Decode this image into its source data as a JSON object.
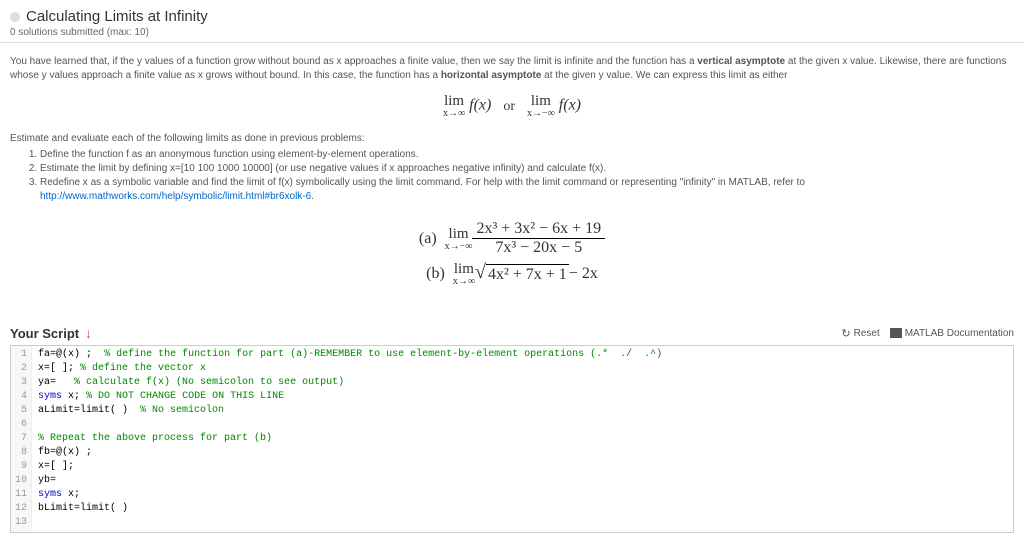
{
  "header": {
    "title": "Calculating Limits at Infinity",
    "subtitle": "0 solutions submitted (max: 10)"
  },
  "content": {
    "intro_p1": "You have learned that, if the y values of a function grow without bound as x approaches a finite value, then we say the limit is infinite and the function has a ",
    "intro_b1": "vertical asymptote",
    "intro_p2": " at the given x value. Likewise, there are functions whose y values approach a finite value as x grows without bound. In this case, the function has a ",
    "intro_b2": "horizontal asymptote",
    "intro_p3": " at the given y value. We can express this limit as either",
    "math_lim": "lim",
    "math_xpinf": "x→∞",
    "math_xninf": "x→−∞",
    "math_fx": "f(x)",
    "math_or": "or",
    "instruct": "Estimate and evaluate each of the following limits as done in previous problems:",
    "steps": [
      "Define the function f as an anonymous function using element-by-element operations.",
      "Estimate the limit by defining x=[10 100 1000 10000] (or use negative values if x approaches negative infinity) and calculate f(x).",
      "Redefine x as a symbolic variable and find the limit of f(x) symbolically using the limit command. For help with the limit command or representing \"infinity\" in MATLAB, refer to "
    ],
    "step3_link": "http://www.mathworks.com/help/symbolic/limit.html#br6xolk-6",
    "step3_tail": ".",
    "prob_a_label": "(a)",
    "prob_a_lim_sub": "x→−∞",
    "prob_a_num": "2x³ + 3x² − 6x + 19",
    "prob_a_den": "7x³ − 20x − 5",
    "prob_b_label": "(b)",
    "prob_b_lim_sub": "x→∞",
    "prob_b_sqrt_body": "4x² + 7x + 1",
    "prob_b_tail": " − 2x"
  },
  "script": {
    "title": "Your Script",
    "reset": "Reset",
    "docs": "MATLAB Documentation",
    "lines": [
      {
        "n": "1",
        "pre": "fa=",
        "at": "@",
        "mid": "(x) ;  ",
        "cm": "% define the function for part (a)-REMEMBER to use element-by-element operations (.*  ./  .^)"
      },
      {
        "n": "2",
        "pre": "x=[ ]; ",
        "cm": "% define the vector x"
      },
      {
        "n": "3",
        "pre": "ya=   ",
        "cm": "% calculate f(x) (No semicolon to see output)"
      },
      {
        "n": "4",
        "kw": "syms",
        "mid": " x; ",
        "cm": "% DO NOT CHANGE CODE ON THIS LINE"
      },
      {
        "n": "5",
        "pre": "aLimit=limit( )  ",
        "cm": "% No semicolon"
      },
      {
        "n": "6",
        "pre": ""
      },
      {
        "n": "7",
        "cm": "% Repeat the above process for part (b)"
      },
      {
        "n": "8",
        "pre": "fb=",
        "at": "@",
        "mid": "(x) ;"
      },
      {
        "n": "9",
        "pre": "x=[ ];"
      },
      {
        "n": "10",
        "pre": "yb="
      },
      {
        "n": "11",
        "kw": "syms",
        "mid": " x;"
      },
      {
        "n": "12",
        "pre": "bLimit=limit( )"
      },
      {
        "n": "13",
        "pre": ""
      }
    ]
  }
}
